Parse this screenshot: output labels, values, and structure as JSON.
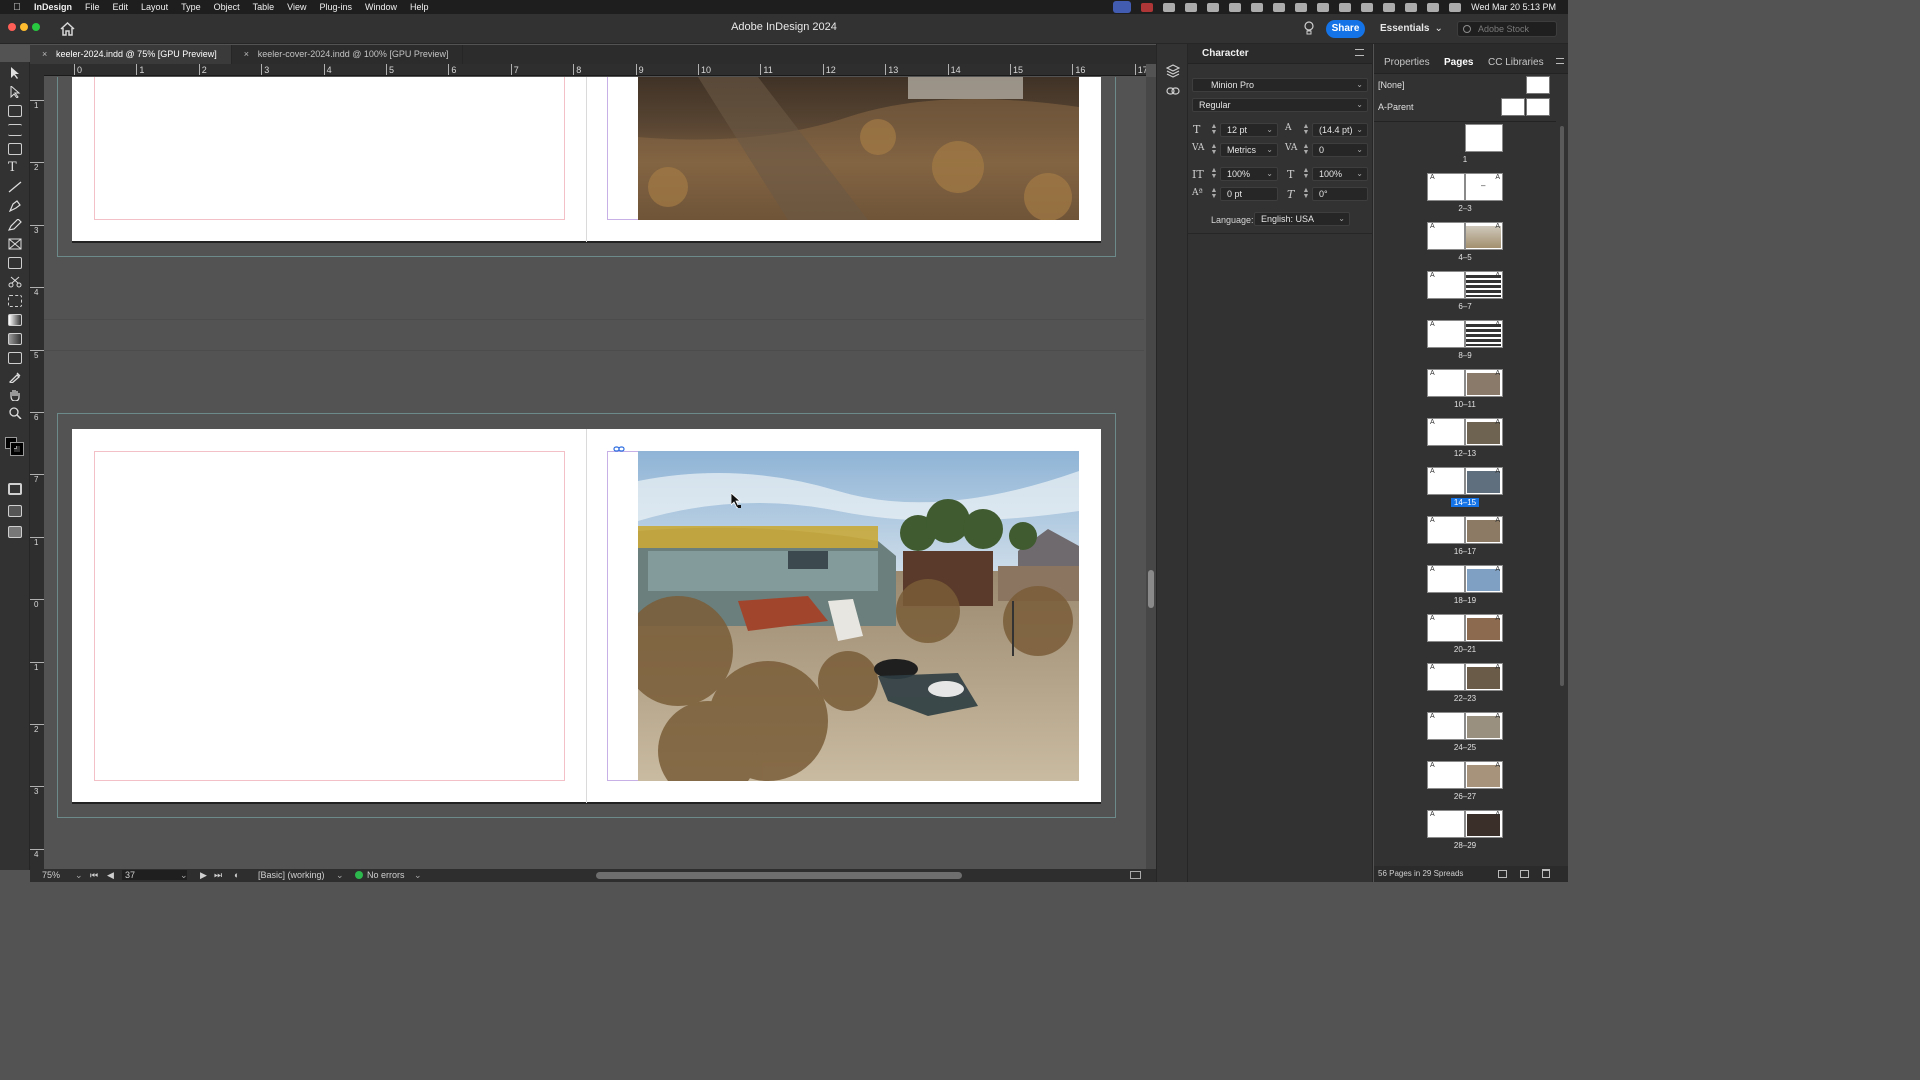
{
  "menubar": {
    "app_name": "InDesign",
    "items": [
      "File",
      "Edit",
      "Layout",
      "Type",
      "Object",
      "Table",
      "View",
      "Plug-ins",
      "Window",
      "Help"
    ],
    "datetime": "Wed Mar 20  5:13 PM"
  },
  "window": {
    "title": "Adobe InDesign 2024",
    "share_label": "Share",
    "workspace_label": "Essentials",
    "stock_placeholder": "Adobe Stock"
  },
  "doc_tabs": [
    {
      "label": "keeler-2024.indd @ 75% [GPU Preview]",
      "active": true
    },
    {
      "label": "keeler-cover-2024.indd @ 100% [GPU Preview]",
      "active": false
    }
  ],
  "ruler": {
    "top_labels": [
      "0",
      "1",
      "2",
      "3",
      "4",
      "5",
      "6",
      "7",
      "8",
      "9",
      "10",
      "11",
      "12",
      "13",
      "14",
      "15",
      "16",
      "17"
    ],
    "left_labels": [
      "1",
      "2",
      "3",
      "4",
      "5",
      "6",
      "7",
      "1",
      "0",
      "1",
      "2",
      "3",
      "4"
    ]
  },
  "character_panel": {
    "title": "Character",
    "font_family": "Minion Pro",
    "font_style": "Regular",
    "size": "12 pt",
    "leading": "(14.4 pt)",
    "kerning": "Metrics",
    "tracking": "0",
    "vertical_scale": "100%",
    "horizontal_scale": "100%",
    "baseline_shift": "0 pt",
    "skew": "0°",
    "language_label": "Language:",
    "language": "English: USA"
  },
  "pages_panel": {
    "tabs": [
      "Properties",
      "Pages",
      "CC Libraries"
    ],
    "active_tab": "Pages",
    "parents": [
      "[None]",
      "A-Parent"
    ],
    "spreads": [
      {
        "label": "1",
        "selected": false
      },
      {
        "label": "2–3",
        "selected": false
      },
      {
        "label": "4–5",
        "selected": false
      },
      {
        "label": "6–7",
        "selected": false
      },
      {
        "label": "8–9",
        "selected": false
      },
      {
        "label": "10–11",
        "selected": false
      },
      {
        "label": "12–13",
        "selected": false
      },
      {
        "label": "14–15",
        "selected": true
      },
      {
        "label": "16–17",
        "selected": false
      },
      {
        "label": "18–19",
        "selected": false
      },
      {
        "label": "20–21",
        "selected": false
      },
      {
        "label": "22–23",
        "selected": false
      },
      {
        "label": "24–25",
        "selected": false
      },
      {
        "label": "26–27",
        "selected": false
      },
      {
        "label": "28–29",
        "selected": false
      }
    ],
    "footer": "56 Pages in 29 Spreads"
  },
  "status": {
    "zoom": "75%",
    "page": "37",
    "style": "[Basic] (working)",
    "errors": "No errors"
  },
  "colors": {
    "accent": "#1473e6",
    "app_bg": "#535353",
    "panel_bg": "#323232",
    "ok_green": "#2db84d"
  }
}
